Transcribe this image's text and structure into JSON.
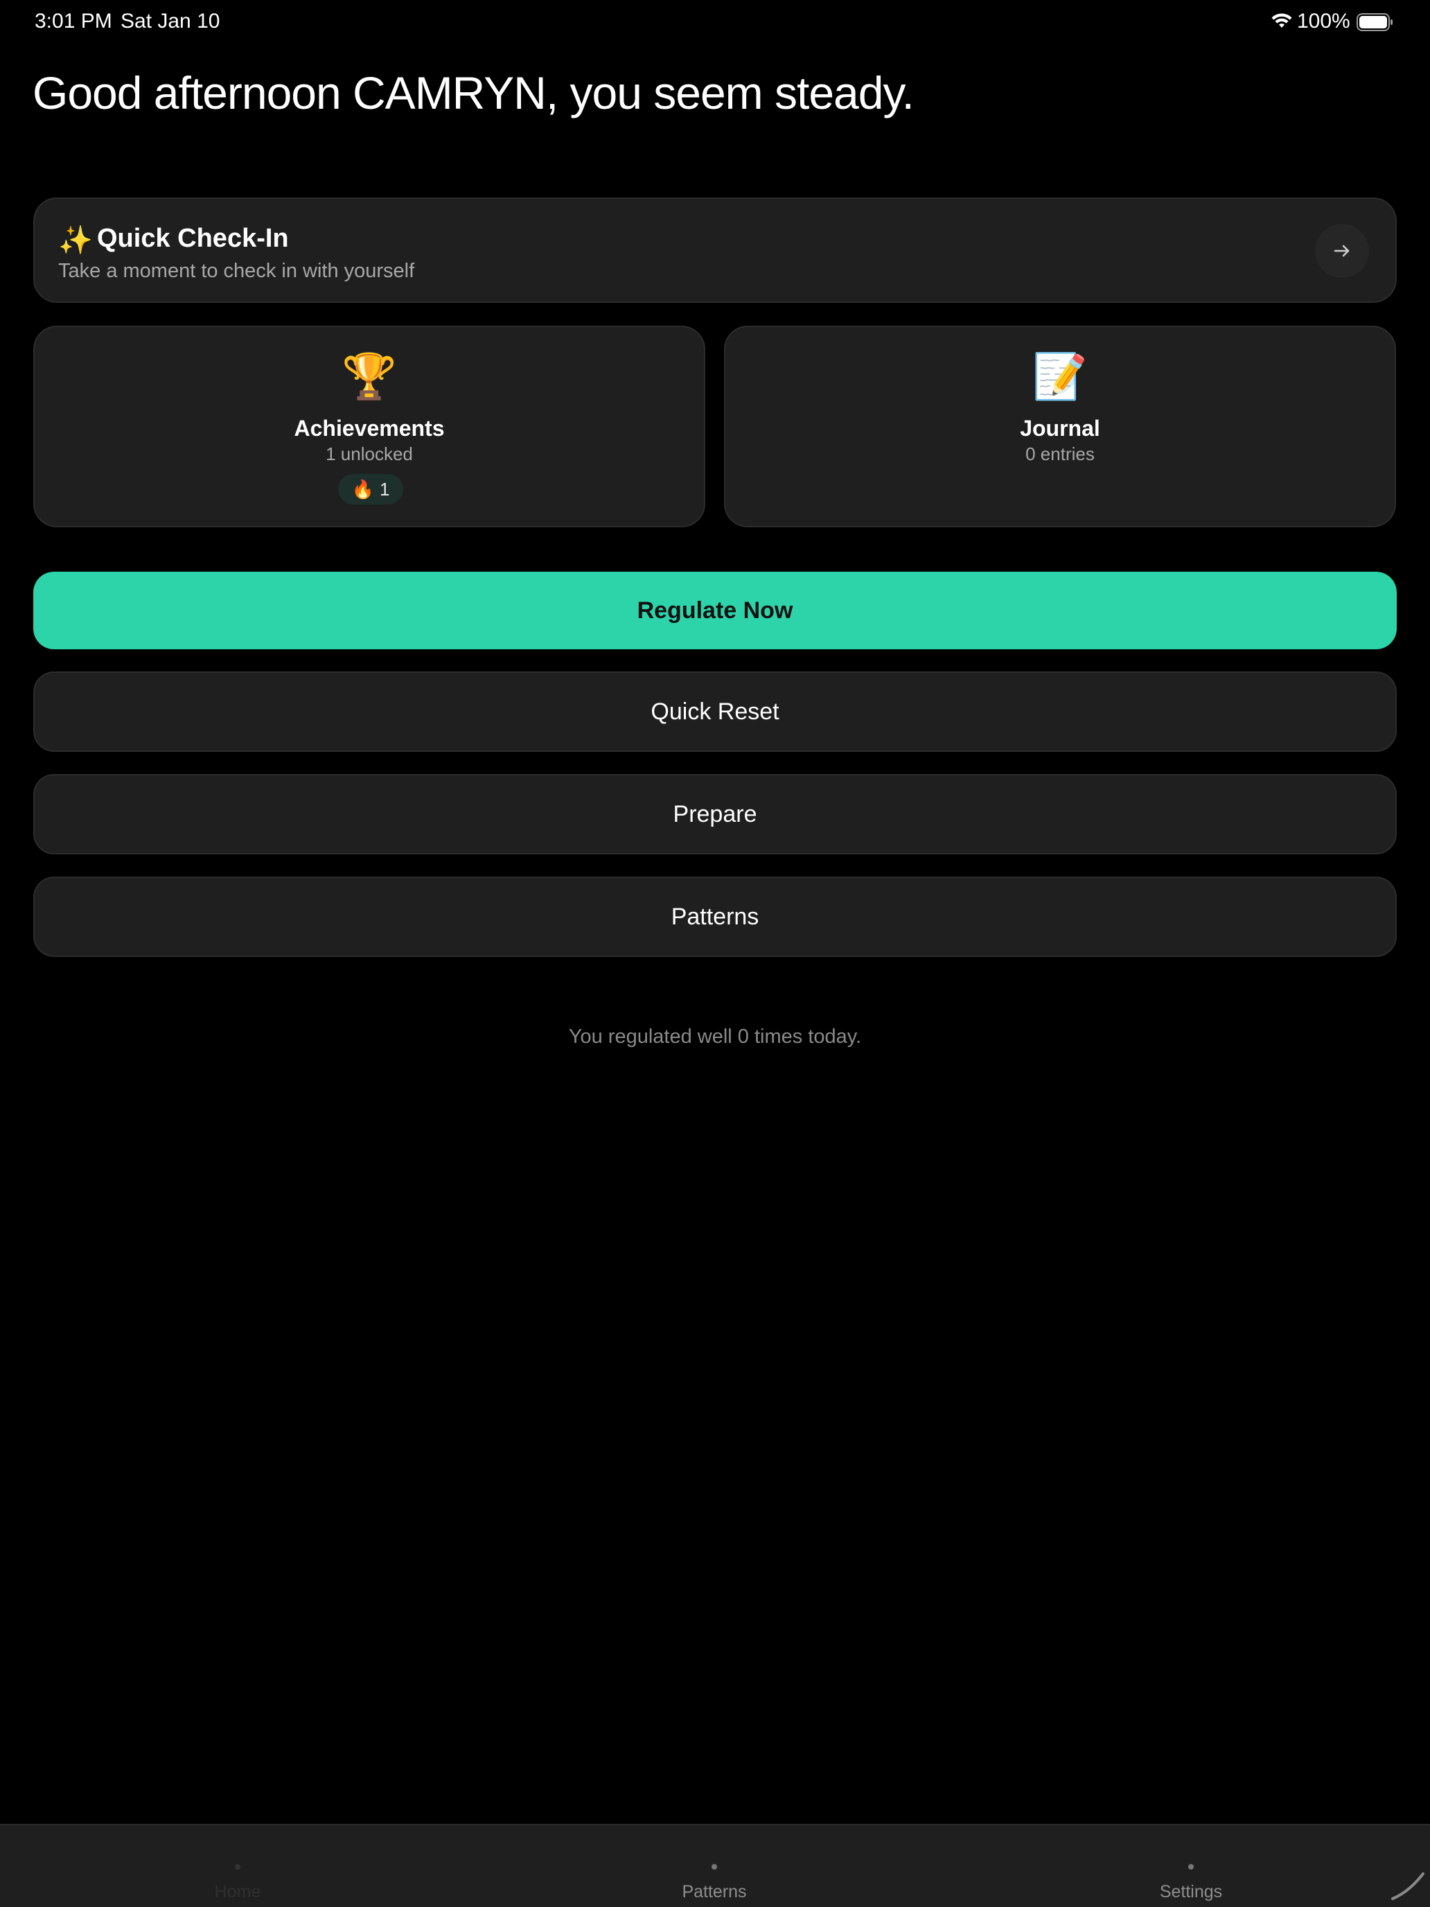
{
  "status_bar": {
    "time": "3:01 PM",
    "date": "Sat Jan 10",
    "battery_percent": "100%",
    "wifi_icon": "wifi-icon",
    "battery_icon": "battery-full-icon"
  },
  "greeting": "Good afternoon CAMRYN, you seem steady.",
  "checkin": {
    "icon": "✨",
    "title": "Quick Check-In",
    "subtitle": "Take a moment to check in with yourself",
    "arrow_icon": "arrow-right-icon"
  },
  "tiles": {
    "achievements": {
      "emoji": "🏆",
      "title": "Achievements",
      "subtitle": "1 unlocked",
      "badge_icon": "🔥",
      "badge_count": "1"
    },
    "journal": {
      "emoji": "📝",
      "title": "Journal",
      "subtitle": "0 entries"
    }
  },
  "actions": {
    "regulate_now": "Regulate Now",
    "quick_reset": "Quick Reset",
    "prepare": "Prepare",
    "patterns": "Patterns"
  },
  "summary": "You regulated well 0 times today.",
  "tab_bar": {
    "tabs": [
      {
        "label": "Home"
      },
      {
        "label": "Patterns"
      },
      {
        "label": "Settings"
      }
    ]
  },
  "colors": {
    "background": "#000000",
    "card": "#1f1f1f",
    "accent": "#2dd4a9",
    "muted_text": "#a8a8a8"
  }
}
